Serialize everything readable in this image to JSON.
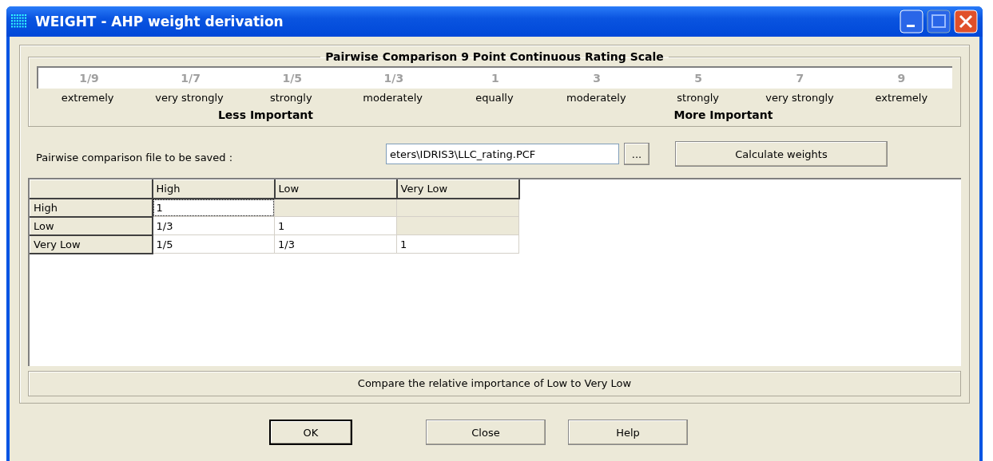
{
  "window": {
    "title": "WEIGHT - AHP weight derivation"
  },
  "scale": {
    "title": "Pairwise Comparison 9 Point Continuous Rating Scale",
    "points": [
      {
        "value": "1/9",
        "label": "extremely"
      },
      {
        "value": "1/7",
        "label": "very strongly"
      },
      {
        "value": "1/5",
        "label": "strongly"
      },
      {
        "value": "1/3",
        "label": "moderately"
      },
      {
        "value": "1",
        "label": "equally"
      },
      {
        "value": "3",
        "label": "moderately"
      },
      {
        "value": "5",
        "label": "strongly"
      },
      {
        "value": "7",
        "label": "very strongly"
      },
      {
        "value": "9",
        "label": "extremely"
      }
    ],
    "left_caption": "Less Important",
    "right_caption": "More Important"
  },
  "file": {
    "label": "Pairwise comparison file to be saved :",
    "value": "eters\\IDRIS3\\LLC_rating.PCF",
    "browse": "...",
    "calculate": "Calculate weights"
  },
  "table": {
    "columns": [
      "High",
      "Low",
      "Very Low"
    ],
    "rows": [
      {
        "header": "High",
        "cells": [
          {
            "kind": "value",
            "text": "1",
            "focused": true
          },
          {
            "kind": "locked"
          },
          {
            "kind": "locked"
          }
        ]
      },
      {
        "header": "Low",
        "cells": [
          {
            "kind": "value",
            "text": "1/3",
            "focused": false
          },
          {
            "kind": "value",
            "text": "1",
            "focused": false
          },
          {
            "kind": "locked"
          }
        ]
      },
      {
        "header": "Very Low",
        "cells": [
          {
            "kind": "value",
            "text": "1/5",
            "focused": false
          },
          {
            "kind": "value",
            "text": "1/3",
            "focused": false
          },
          {
            "kind": "value",
            "text": "1",
            "focused": false
          }
        ]
      }
    ]
  },
  "status": "Compare the relative importance of Low to Very Low",
  "buttons": [
    {
      "label": "OK",
      "default": true
    },
    {
      "label": "Close",
      "default": false
    },
    {
      "label": "Help",
      "default": false
    }
  ]
}
